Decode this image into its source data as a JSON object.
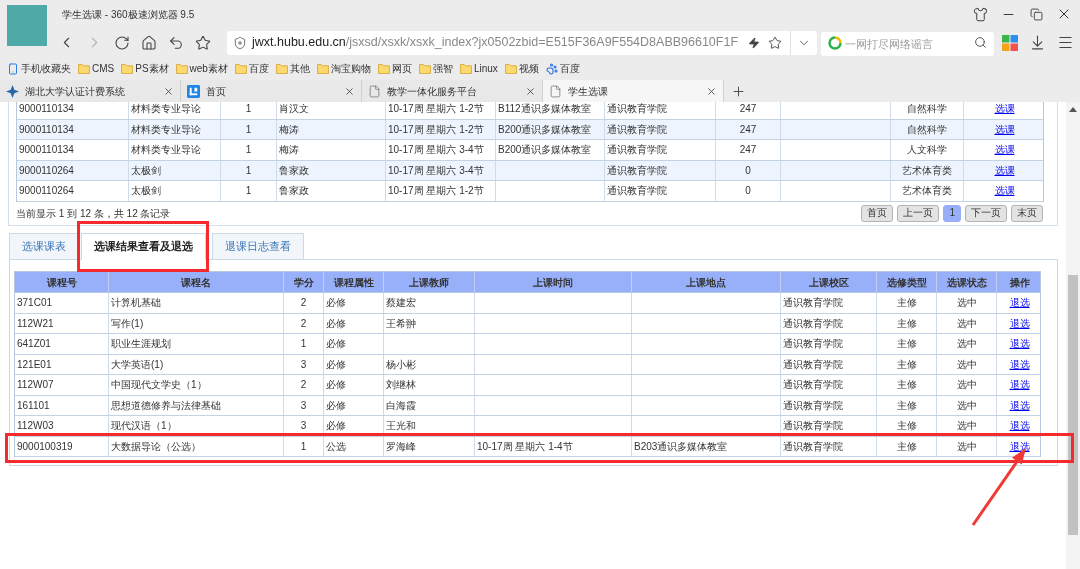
{
  "window": {
    "title": "学生选课 - 360极速浏览器 9.5"
  },
  "forward_button": {
    "disabled": true
  },
  "address_bar": {
    "host": "jwxt.hubu.edu.cn",
    "path": "/jsxsd/xsxk/xsxk_index?jx0502zbid=E515F36A9F554D8ABB96610F1F"
  },
  "search": {
    "placeholder": "一网打尽网络谣言"
  },
  "bookmarks": [
    {
      "kind": "mobile",
      "label": "手机收藏夹"
    },
    {
      "kind": "folder",
      "label": "CMS"
    },
    {
      "kind": "folder",
      "label": "PS素材"
    },
    {
      "kind": "folder",
      "label": "web素材"
    },
    {
      "kind": "folder",
      "label": "百度"
    },
    {
      "kind": "folder",
      "label": "其他"
    },
    {
      "kind": "folder",
      "label": "淘宝购物"
    },
    {
      "kind": "folder",
      "label": "网页"
    },
    {
      "kind": "folder",
      "label": "强智"
    },
    {
      "kind": "folder",
      "label": "Linux"
    },
    {
      "kind": "folder",
      "label": "视频"
    },
    {
      "kind": "site",
      "label": "百度"
    }
  ],
  "tabs": [
    {
      "label": "湖北大学认证计费系统",
      "selected": false
    },
    {
      "label": "首页",
      "selected": false
    },
    {
      "label": "教学一体化服务平台",
      "selected": false
    },
    {
      "label": "学生选课",
      "selected": true
    }
  ],
  "course_list": {
    "rows": [
      {
        "column_1": "9000110134",
        "column_2": "材料类专业导论",
        "column_3": "1",
        "column_4": "肖汉文",
        "column_5": "10-17周 星期六 1-2节",
        "column_6": "B112通识多媒体教室",
        "column_7": "通识教育学院",
        "column_8": "247",
        "column_10": "自然科学",
        "column_11": "选课"
      },
      {
        "column_1": "9000110134",
        "column_2": "材料类专业导论",
        "column_3": "1",
        "column_4": "梅涛",
        "column_5": "10-17周 星期六 1-2节",
        "column_6": "B200通识多媒体教室",
        "column_7": "通识教育学院",
        "column_8": "247",
        "column_10": "自然科学",
        "column_11": "选课"
      },
      {
        "column_1": "9000110134",
        "column_2": "材料类专业导论",
        "column_3": "1",
        "column_4": "梅涛",
        "column_5": "10-17周 星期六 3-4节",
        "column_6": "B200通识多媒体教室",
        "column_7": "通识教育学院",
        "column_8": "247",
        "column_10": "人文科学",
        "column_11": "选课"
      },
      {
        "column_1": "9000110264",
        "column_2": "太极剑",
        "column_3": "1",
        "column_4": "鲁家政",
        "column_5": "10-17周 星期六 3-4节",
        "column_7": "通识教育学院",
        "column_8": "0",
        "column_10": "艺术体育类",
        "column_11": "选课"
      },
      {
        "column_1": "9000110264",
        "column_2": "太极剑",
        "column_3": "1",
        "column_4": "鲁家政",
        "column_5": "10-17周 星期六 1-2节",
        "column_7": "通识教育学院",
        "column_8": "0",
        "column_10": "艺术体育类",
        "column_11": "选课"
      }
    ],
    "summary": "当前显示 1 到 12 条，共 12 条记录",
    "pagination": [
      {
        "label": "首页",
        "selected": false
      },
      {
        "label": "上一页",
        "selected": false
      },
      {
        "label": "1",
        "selected": true
      },
      {
        "label": "下一页",
        "selected": false
      },
      {
        "label": "末页",
        "selected": false
      }
    ]
  },
  "result_tabs": [
    {
      "label": "选课课表",
      "selected": false,
      "marked": false
    },
    {
      "label": "选课结果查看及退选",
      "selected": true,
      "marked": true
    },
    {
      "label": "退课日志查看",
      "selected": false,
      "marked": false
    }
  ],
  "selected_courses": {
    "columns": [
      "课程号",
      "课程名",
      "学分",
      "课程属性",
      "上课教师",
      "上课时间",
      "上课地点",
      "上课校区",
      "选修类型",
      "选课状态",
      "操作"
    ],
    "rows": [
      {
        "course_no": "371C01",
        "course_name": "计算机基础",
        "credit": "2",
        "attribute": "必修",
        "teacher": "蔡建宏",
        "campus": "通识教育学院",
        "elective_type": "主修",
        "status": "选中",
        "action": "退选",
        "marked": false
      },
      {
        "course_no": "112W21",
        "course_name": "写作(1)",
        "credit": "2",
        "attribute": "必修",
        "teacher": "王希翀",
        "campus": "通识教育学院",
        "elective_type": "主修",
        "status": "选中",
        "action": "退选",
        "marked": false
      },
      {
        "course_no": "641Z01",
        "course_name": "职业生涯规划",
        "credit": "1",
        "attribute": "必修",
        "campus": "通识教育学院",
        "elective_type": "主修",
        "status": "选中",
        "action": "退选",
        "marked": false
      },
      {
        "course_no": "121E01",
        "course_name": "大学英语(1)",
        "credit": "3",
        "attribute": "必修",
        "teacher": "杨小彬",
        "campus": "通识教育学院",
        "elective_type": "主修",
        "status": "选中",
        "action": "退选",
        "marked": false
      },
      {
        "course_no": "112W07",
        "course_name": "中国现代文学史（1）",
        "credit": "2",
        "attribute": "必修",
        "teacher": "刘继林",
        "campus": "通识教育学院",
        "elective_type": "主修",
        "status": "选中",
        "action": "退选",
        "marked": false
      },
      {
        "course_no": "161101",
        "course_name": "思想道德修养与法律基础",
        "credit": "3",
        "attribute": "必修",
        "teacher": "白海霞",
        "campus": "通识教育学院",
        "elective_type": "主修",
        "status": "选中",
        "action": "退选",
        "marked": false
      },
      {
        "course_no": "112W03",
        "course_name": "现代汉语（1）",
        "credit": "3",
        "attribute": "必修",
        "teacher": "王光和",
        "campus": "通识教育学院",
        "elective_type": "主修",
        "status": "选中",
        "action": "退选",
        "marked": false
      },
      {
        "course_no": "9000100319",
        "course_name": "大数据导论（公选）",
        "credit": "1",
        "attribute": "公选",
        "teacher": "罗海峰",
        "time": "10-17周 星期六 1-4节",
        "place": "B203通识多媒体教室",
        "campus": "通识教育学院",
        "elective_type": "主修",
        "status": "选中",
        "action": "退选",
        "marked": true
      }
    ]
  }
}
